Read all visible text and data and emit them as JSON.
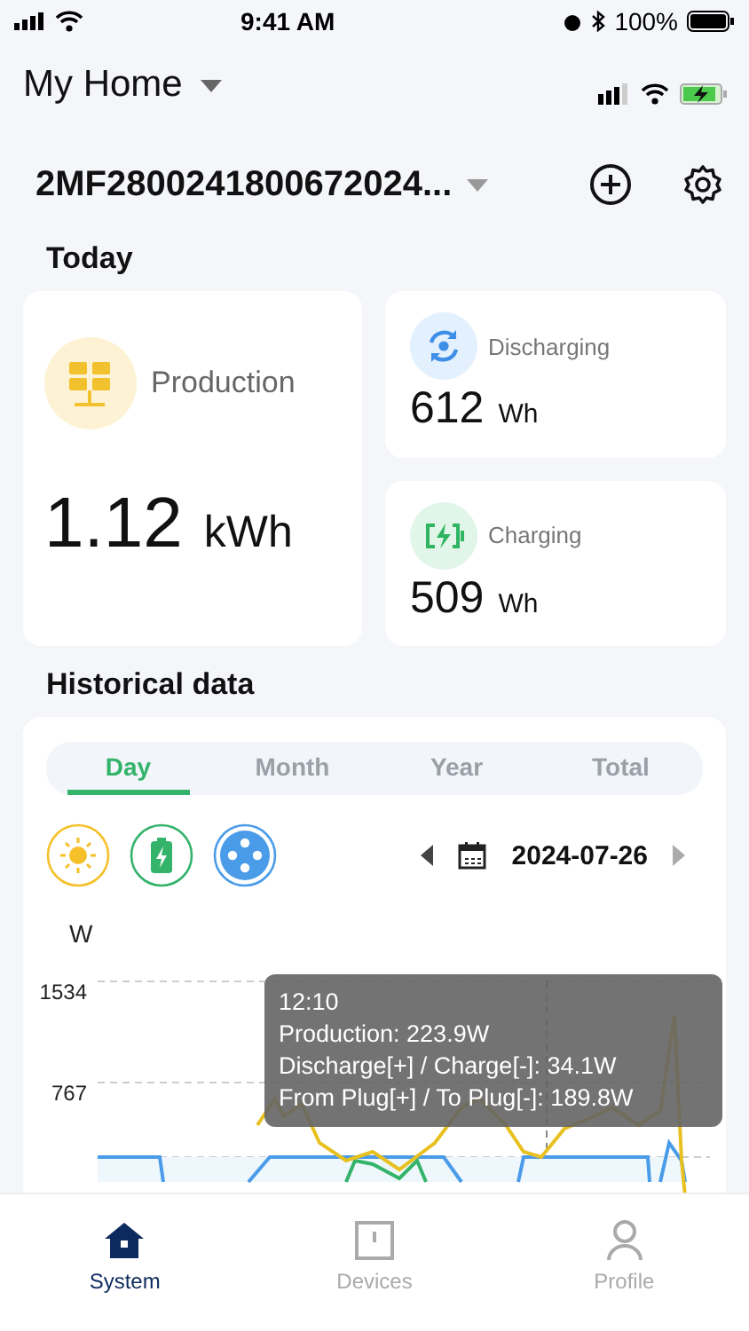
{
  "status_bar": {
    "time": "9:41 AM",
    "battery": "100%"
  },
  "header": {
    "home": "My Home"
  },
  "device": {
    "serial": "2MF2800241800672024..."
  },
  "today": {
    "title": "Today",
    "production": {
      "label": "Production",
      "value": "1.12",
      "unit": "kWh"
    },
    "stats": [
      {
        "kind": "discharging",
        "label": "Discharging",
        "value": "612",
        "unit": "Wh"
      },
      {
        "kind": "charging",
        "label": "Charging",
        "value": "509",
        "unit": "Wh"
      }
    ]
  },
  "history": {
    "title": "Historical data",
    "tabs": [
      {
        "label": "Day",
        "selected": true
      },
      {
        "label": "Month",
        "selected": false
      },
      {
        "label": "Year",
        "selected": false
      },
      {
        "label": "Total",
        "selected": false
      }
    ],
    "filters": [
      {
        "kind": "sun",
        "color": "#f5c02a"
      },
      {
        "kind": "battery",
        "color": "#34b36b"
      },
      {
        "kind": "plug",
        "color": "#4a9be8"
      }
    ],
    "date": "2024-07-26",
    "chart": {
      "unit": "W",
      "y_labels": [
        "1534",
        "767"
      ],
      "tooltip": [
        "12:10",
        "Production: 223.9W",
        "Discharge[+] / Charge[-]: 34.1W",
        "From Plug[+] / To Plug[-]: 189.8W"
      ]
    }
  },
  "tab_bar": [
    {
      "kind": "home",
      "label": "System",
      "selected": true
    },
    {
      "kind": "device",
      "label": "Devices",
      "selected": false
    },
    {
      "kind": "person",
      "label": "Profile",
      "selected": false
    }
  ]
}
